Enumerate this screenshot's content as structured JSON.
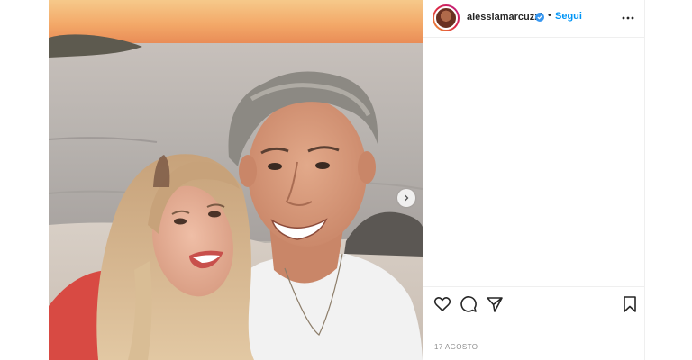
{
  "post": {
    "username": "alessiamarcuzzi",
    "follow_label": "Segui",
    "separator": "•",
    "date": "17 AGOSTO"
  },
  "icons": {
    "avatar": "profile-avatar",
    "verified": "verified-badge-icon",
    "more": "more-options-icon",
    "next": "chevron-right-icon",
    "like": "heart-icon",
    "comment": "comment-icon",
    "share": "paper-plane-icon",
    "save": "bookmark-icon"
  },
  "colors": {
    "link_blue": "#0095f6",
    "text": "#262626",
    "muted": "#8e8e8e"
  }
}
